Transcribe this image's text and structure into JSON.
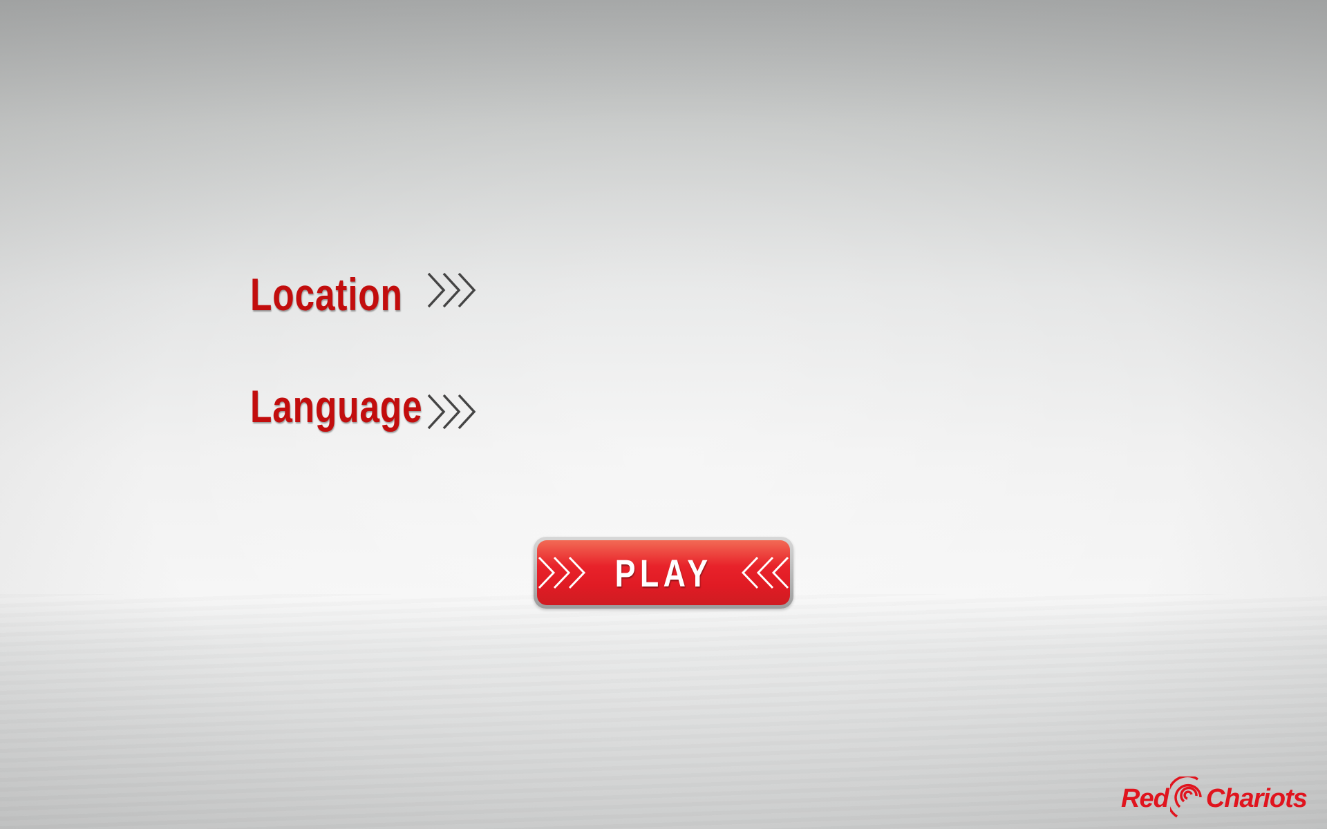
{
  "menu": {
    "location_label": "Location",
    "language_label": "Language"
  },
  "play_button": {
    "label": "PLAY"
  },
  "logo": {
    "part1": "Red",
    "part2": "Chariots"
  },
  "colors": {
    "accent": "#c20d0d",
    "button": "#e01b24",
    "logo": "#e0141e"
  }
}
